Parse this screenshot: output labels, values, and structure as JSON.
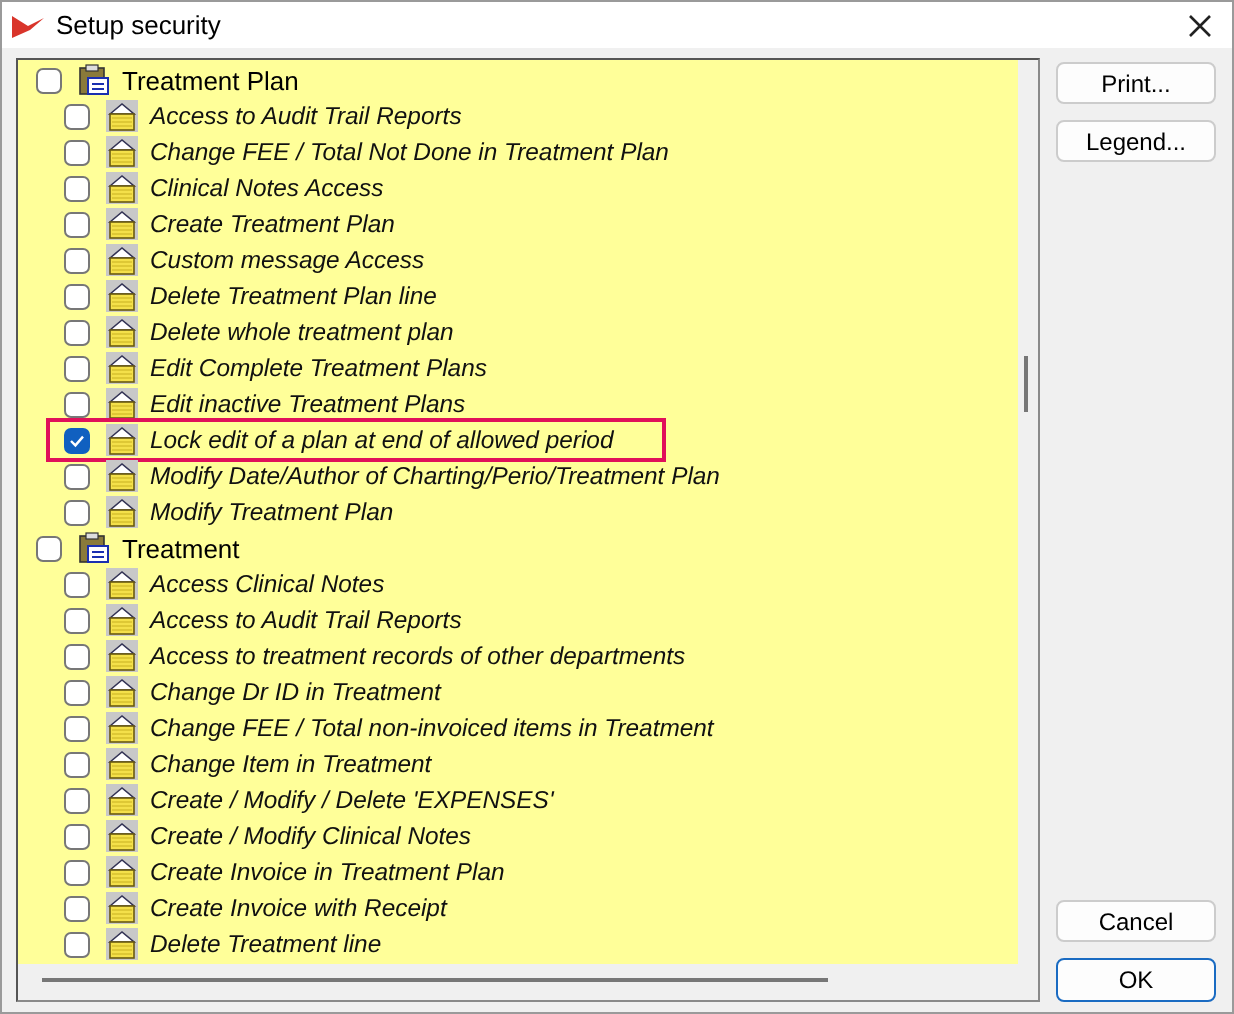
{
  "window": {
    "title": "Setup security"
  },
  "tree": [
    {
      "label": "Treatment Plan",
      "checked": false,
      "children": [
        {
          "label": "Access to Audit Trail Reports",
          "checked": false,
          "highlighted": false
        },
        {
          "label": "Change FEE / Total Not Done in Treatment Plan",
          "checked": false,
          "highlighted": false
        },
        {
          "label": "Clinical Notes Access",
          "checked": false,
          "highlighted": false
        },
        {
          "label": "Create Treatment Plan",
          "checked": false,
          "highlighted": false
        },
        {
          "label": "Custom message Access",
          "checked": false,
          "highlighted": false
        },
        {
          "label": "Delete Treatment Plan line",
          "checked": false,
          "highlighted": false
        },
        {
          "label": "Delete whole treatment plan",
          "checked": false,
          "highlighted": false
        },
        {
          "label": "Edit Complete Treatment Plans",
          "checked": false,
          "highlighted": false
        },
        {
          "label": "Edit inactive Treatment Plans",
          "checked": false,
          "highlighted": false
        },
        {
          "label": "Lock edit of a plan at end of allowed period",
          "checked": true,
          "highlighted": true
        },
        {
          "label": "Modify Date/Author of Charting/Perio/Treatment Plan",
          "checked": false,
          "highlighted": false
        },
        {
          "label": "Modify Treatment Plan",
          "checked": false,
          "highlighted": false
        }
      ]
    },
    {
      "label": "Treatment",
      "checked": false,
      "children": [
        {
          "label": "Access Clinical Notes",
          "checked": false,
          "highlighted": false
        },
        {
          "label": "Access to Audit Trail Reports",
          "checked": false,
          "highlighted": false
        },
        {
          "label": "Access to treatment records of other departments",
          "checked": false,
          "highlighted": false
        },
        {
          "label": "Change Dr ID in Treatment",
          "checked": false,
          "highlighted": false
        },
        {
          "label": "Change FEE / Total non-invoiced items in Treatment",
          "checked": false,
          "highlighted": false
        },
        {
          "label": "Change Item in Treatment",
          "checked": false,
          "highlighted": false
        },
        {
          "label": "Create / Modify / Delete 'EXPENSES'",
          "checked": false,
          "highlighted": false
        },
        {
          "label": "Create / Modify Clinical Notes",
          "checked": false,
          "highlighted": false
        },
        {
          "label": "Create Invoice in Treatment Plan",
          "checked": false,
          "highlighted": false
        },
        {
          "label": "Create Invoice with Receipt",
          "checked": false,
          "highlighted": false
        },
        {
          "label": "Delete Treatment line",
          "checked": false,
          "highlighted": false
        }
      ]
    }
  ],
  "side_buttons": [
    "Print...",
    "Legend..."
  ],
  "bottom_buttons": [
    {
      "label": "Cancel",
      "default": false
    },
    {
      "label": "OK",
      "default": true
    }
  ]
}
